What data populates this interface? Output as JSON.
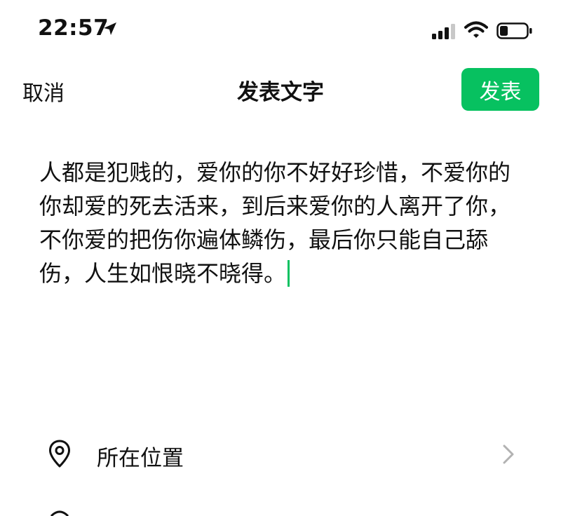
{
  "status_bar": {
    "time": "22:57",
    "icons": [
      "location-arrow-icon",
      "cellular-signal-icon",
      "wifi-icon",
      "battery-icon"
    ]
  },
  "nav": {
    "cancel_label": "取消",
    "title": "发表文字",
    "publish_label": "发表"
  },
  "post": {
    "text": "人都是犯贱的，爱你的你不好好珍惜，不爱你的你却爱的死去活来，到后来爱你的人离开了你，不你爱的把伤你遍体鳞伤，最后你只能自己舔伤，人生如恨晓不晓得。"
  },
  "options": {
    "location_label": "所在位置",
    "location_icon": "location-pin-icon",
    "chevron_icon": "chevron-right-icon"
  },
  "colors": {
    "accent": "#07c160",
    "text": "#111111",
    "chevron": "#b2b2b2"
  }
}
